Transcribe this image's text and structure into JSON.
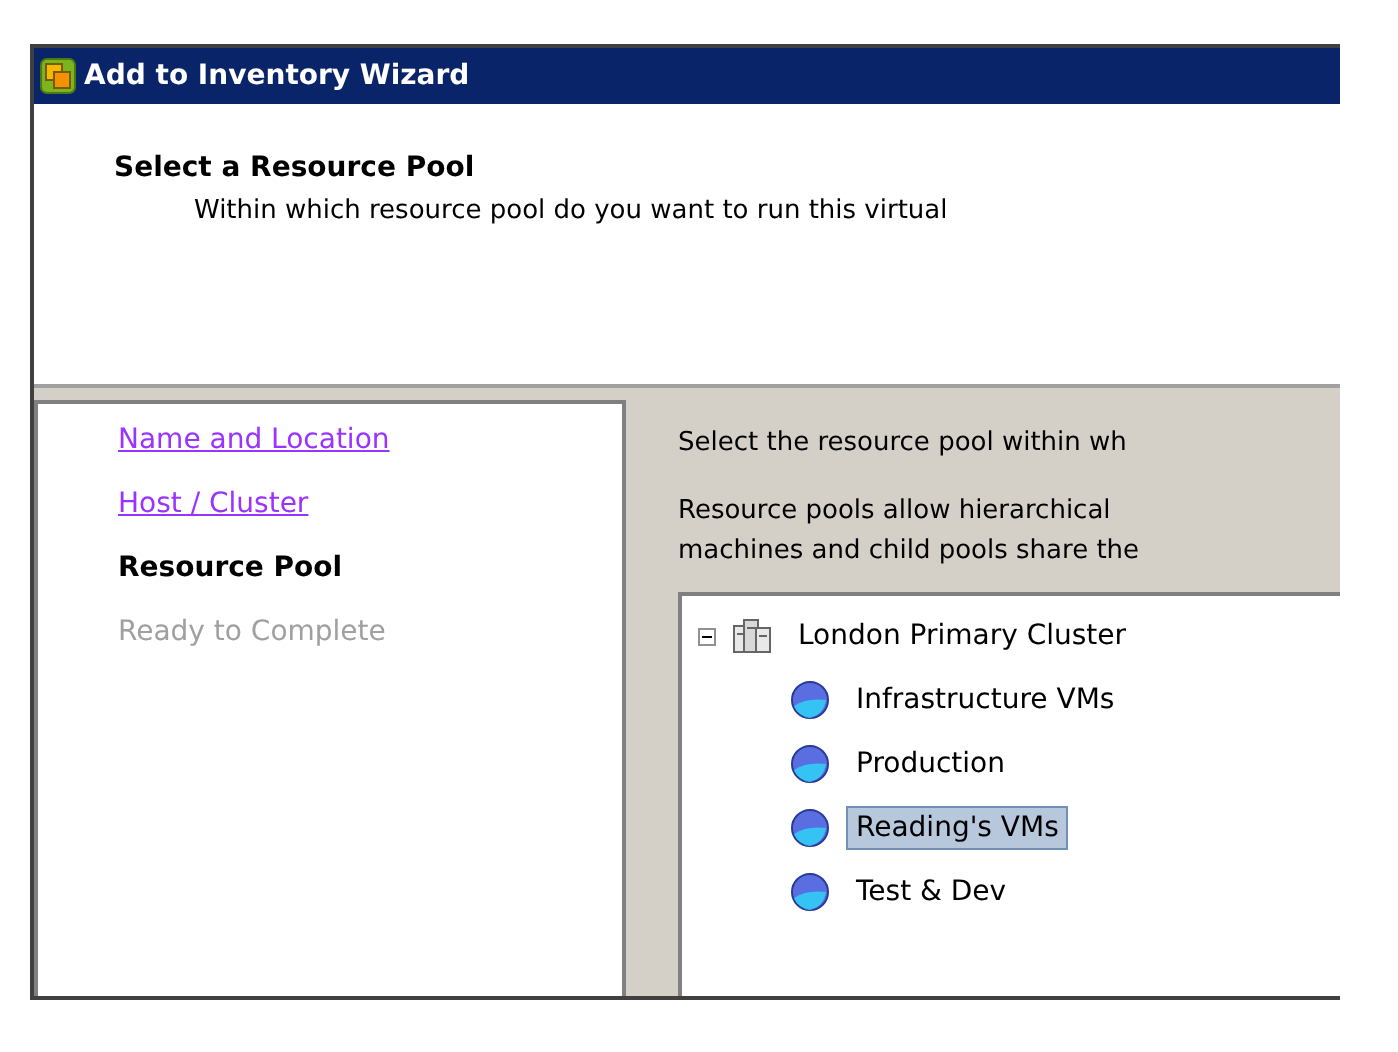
{
  "window": {
    "title": "Add to Inventory Wizard"
  },
  "header": {
    "title": "Select a Resource Pool",
    "subtitle": "Within which resource pool do you want to run this virtual"
  },
  "steps": [
    {
      "label": "Name and Location",
      "kind": "visited"
    },
    {
      "label": "Host / Cluster",
      "kind": "visited"
    },
    {
      "label": "Resource Pool",
      "kind": "current"
    },
    {
      "label": "Ready to Complete",
      "kind": "disabled"
    }
  ],
  "content": {
    "intro": "Select the resource pool within wh",
    "description_lines": [
      "Resource pools allow hierarchical",
      "machines and child pools share the"
    ]
  },
  "tree": [
    {
      "label": "London Primary Cluster",
      "kind": "cluster",
      "expanded": true,
      "selected": false,
      "children": [
        {
          "label": "Infrastructure VMs",
          "kind": "pool",
          "selected": false
        },
        {
          "label": "Production",
          "kind": "pool",
          "selected": false
        },
        {
          "label": "Reading's VMs",
          "kind": "pool",
          "selected": true
        },
        {
          "label": "Test & Dev",
          "kind": "pool",
          "selected": false
        }
      ]
    }
  ]
}
